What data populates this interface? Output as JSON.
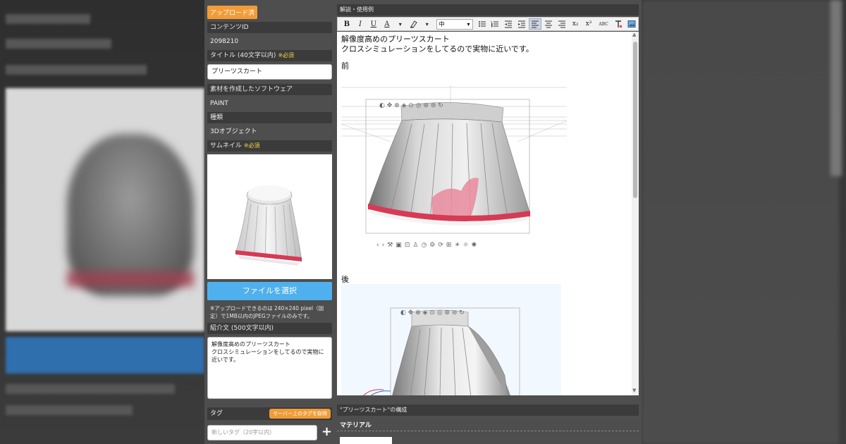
{
  "form": {
    "uploaded_badge": "アップロード済",
    "content_id_label": "コンテンツID",
    "content_id": "2098210",
    "title_label": "タイトル (40文字以内)",
    "required": "※必須",
    "title_value": "プリーツスカート",
    "software_label": "素材を作成したソフトウェア",
    "software_value": "PAINT",
    "type_label": "種類",
    "type_value": "3Dオブジェクト",
    "thumbnail_label": "サムネイル",
    "choose_file": "ファイルを選択",
    "upload_note": "※アップロードできるのは 240×240 pixel（固定）で1MB以内のJPEGファイルのみです。",
    "intro_label": "紹介文 (500文字以内)",
    "intro_value": "解像度高めのプリーツスカート\nクロスシミュレーションをしてるので実物に近いです。",
    "tag_label": "タグ",
    "tag_fetch": "サーバー上のタグを取得",
    "tag_placeholder": "新しいタグ（20字以内）",
    "tag_add": "+"
  },
  "editor": {
    "label": "解説・使用例",
    "font_size": "中",
    "line1": "解像度高めのプリーツスカート",
    "line2": "クロスシミュレーションをしてるので実物に近いです。",
    "front": "前",
    "back": "後",
    "toolbar": {
      "bold": "B",
      "italic": "I",
      "underline": "U",
      "font_color": "A",
      "sub": "x₂",
      "sup": "x²",
      "spell": "ABC"
    }
  },
  "composition": {
    "label": "\"プリーツスカート\"の構成",
    "material": "マテリアル"
  },
  "colors": {
    "accent_orange": "#f29c38",
    "button_blue": "#4fb0ee",
    "required_yellow": "#f5d742",
    "skirt_band_red": "#d63a55"
  }
}
